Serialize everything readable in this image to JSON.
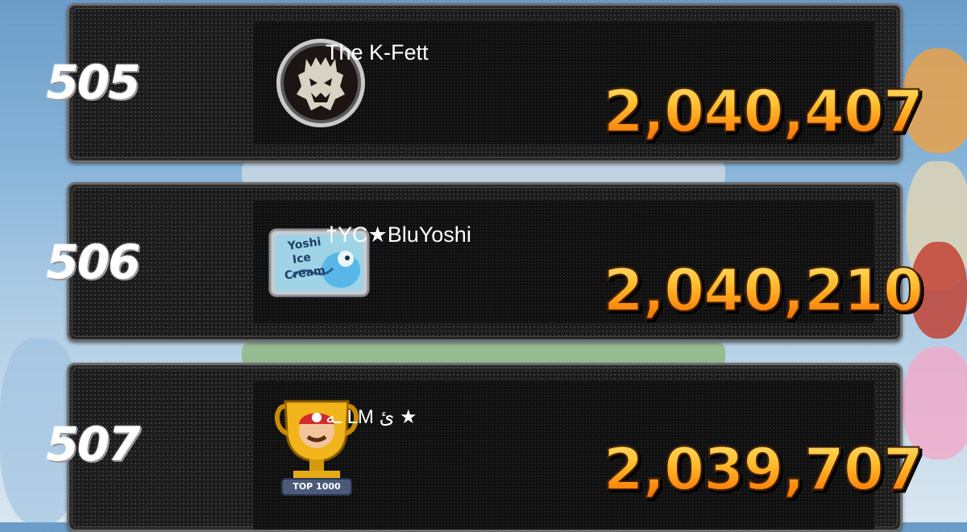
{
  "leaderboard": {
    "rows": [
      {
        "rank": "505",
        "name": "The K-Fett",
        "score": "2,040,407",
        "badge": "bowser-emblem-icon"
      },
      {
        "rank": "506",
        "name": "†YC★BluYoshi",
        "score": "2,040,210",
        "badge": "yoshi-ice-cream-badge"
      },
      {
        "rank": "507",
        "name": "ـه LM ئ ★",
        "score": "2,039,707",
        "badge": "mario-top-1000-trophy-icon"
      }
    ],
    "badge_text": {
      "yoshi_line1": "Yoshi",
      "yoshi_line2": "Ice",
      "yoshi_line3": "Cream",
      "trophy_label": "TOP 1000"
    }
  }
}
